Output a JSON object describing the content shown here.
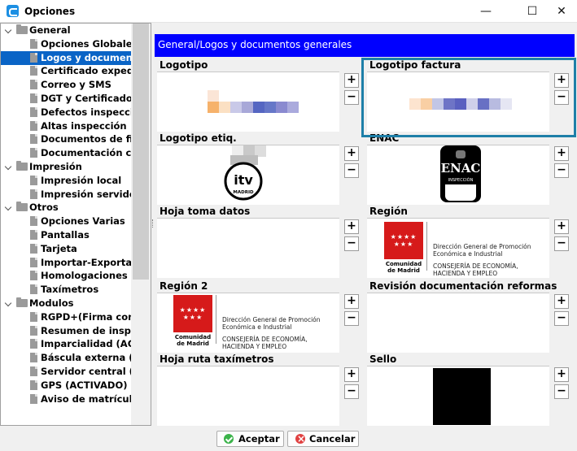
{
  "window": {
    "title": "Opciones",
    "minimize": "—",
    "maximize": "☐",
    "close": "✕"
  },
  "tree": [
    {
      "label": "General",
      "level": 0,
      "type": "folder"
    },
    {
      "label": "Opciones Globales",
      "level": 1,
      "type": "doc"
    },
    {
      "label": "Logos y documentos",
      "level": 1,
      "type": "doc",
      "selected": true
    },
    {
      "label": "Certificado expedie",
      "level": 1,
      "type": "doc"
    },
    {
      "label": "Correo y SMS",
      "level": 1,
      "type": "doc"
    },
    {
      "label": "DGT y Certificados",
      "level": 1,
      "type": "doc"
    },
    {
      "label": "Defectos inspección",
      "level": 1,
      "type": "doc"
    },
    {
      "label": "Altas inspección",
      "level": 1,
      "type": "doc"
    },
    {
      "label": "Documentos de firm",
      "level": 1,
      "type": "doc"
    },
    {
      "label": "Documentación calic",
      "level": 1,
      "type": "doc"
    },
    {
      "label": "Impresión",
      "level": 0,
      "type": "folder"
    },
    {
      "label": "Impresión local",
      "level": 1,
      "type": "doc"
    },
    {
      "label": "Impresión servidor",
      "level": 1,
      "type": "doc"
    },
    {
      "label": "Otros",
      "level": 0,
      "type": "folder"
    },
    {
      "label": "Opciones Varias",
      "level": 1,
      "type": "doc"
    },
    {
      "label": "Pantallas",
      "level": 1,
      "type": "doc"
    },
    {
      "label": "Tarjeta",
      "level": 1,
      "type": "doc"
    },
    {
      "label": "Importar-Exportar",
      "level": 1,
      "type": "doc"
    },
    {
      "label": "Homologaciones",
      "level": 1,
      "type": "doc"
    },
    {
      "label": "Taxímetros",
      "level": 1,
      "type": "doc"
    },
    {
      "label": "Modulos",
      "level": 0,
      "type": "folder"
    },
    {
      "label": "RGPD+(Firma con ta",
      "level": 1,
      "type": "doc"
    },
    {
      "label": "Resumen de inspec",
      "level": 1,
      "type": "doc"
    },
    {
      "label": "Imparcialidad (ACTIV",
      "level": 1,
      "type": "doc"
    },
    {
      "label": "Báscula externa (AC",
      "level": 1,
      "type": "doc"
    },
    {
      "label": "Servidor central (Co",
      "level": 1,
      "type": "doc"
    },
    {
      "label": "GPS (ACTIVADO)",
      "level": 1,
      "type": "doc"
    },
    {
      "label": "Aviso de matrículas",
      "level": 1,
      "type": "doc"
    }
  ],
  "header": {
    "title": "General/Logos y documentos generales"
  },
  "panels": [
    {
      "title": "Logotipo"
    },
    {
      "title": "Logotipo factura"
    },
    {
      "title": "Logotipo etiq."
    },
    {
      "title": "ENAC"
    },
    {
      "title": "Hoja toma datos"
    },
    {
      "title": "Región"
    },
    {
      "title": "Región 2"
    },
    {
      "title": "Revisión documentación  reformas"
    },
    {
      "title": "Hoja ruta taxímetros"
    },
    {
      "title": "Sello"
    }
  ],
  "panel_buttons": {
    "add": "+",
    "remove": "−"
  },
  "logos": {
    "itv_text": "itv",
    "itv_city": "MADRID",
    "enac_text": "ENAC",
    "enac_sub": "INSPECCIÓN",
    "cam_name": "Comunidad de Madrid",
    "cam_line1": "Dirección General de Promoción",
    "cam_line2": "Económica e Industrial",
    "cam_line3": "CONSEJERÍA DE ECONOMÍA,",
    "cam_line4": "HACIENDA Y EMPLEO"
  },
  "buttons": {
    "accept": "Aceptar",
    "cancel": "Cancelar"
  },
  "colors": {
    "header": "#0000ff",
    "selected": "#0a64c6",
    "highlight": "#1e7fa8",
    "cam_red": "#d61a1a"
  }
}
